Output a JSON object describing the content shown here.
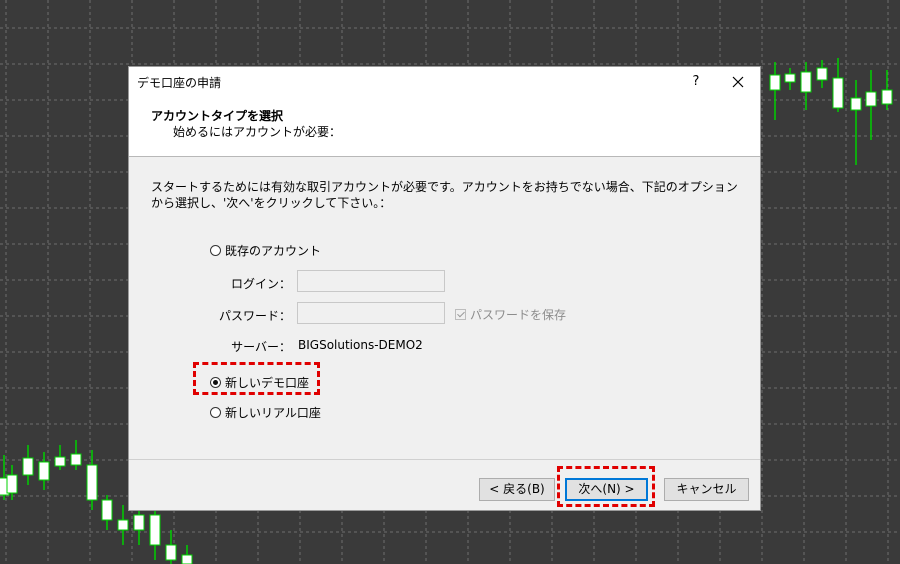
{
  "dialog": {
    "title": "デモ口座の申請",
    "help_label": "?",
    "header_title": "アカウントタイプを選択",
    "header_subtitle": "始めるにはアカウントが必要：",
    "description": "スタートするためには有効な取引アカウントが必要です。アカウントをお持ちでない場合、下記のオプションから選択し、'次へ'をクリックして下さい。："
  },
  "options": {
    "existing_account": "既存のアカウント",
    "new_demo": "新しいデモ口座",
    "new_real": "新しいリアル口座",
    "selected": "new_demo"
  },
  "existing": {
    "login_label": "ログイン：",
    "login_value": "",
    "password_label": "パスワード：",
    "password_value": "",
    "save_password_label": "パスワードを保存",
    "save_password_checked": true,
    "server_label": "サーバー：",
    "server_value": "BIGSolutions-DEMO2"
  },
  "buttons": {
    "back": "< 戻る(B)",
    "next": "次へ(N) >",
    "cancel": "キャンセル"
  },
  "colors": {
    "chart_background": "#3a3a3a",
    "grid": "#6e6e6e",
    "candle_up": "#ffffff",
    "candle_wick": "#00d000",
    "highlight": "#e00000",
    "default_button_border": "#0078d7"
  }
}
